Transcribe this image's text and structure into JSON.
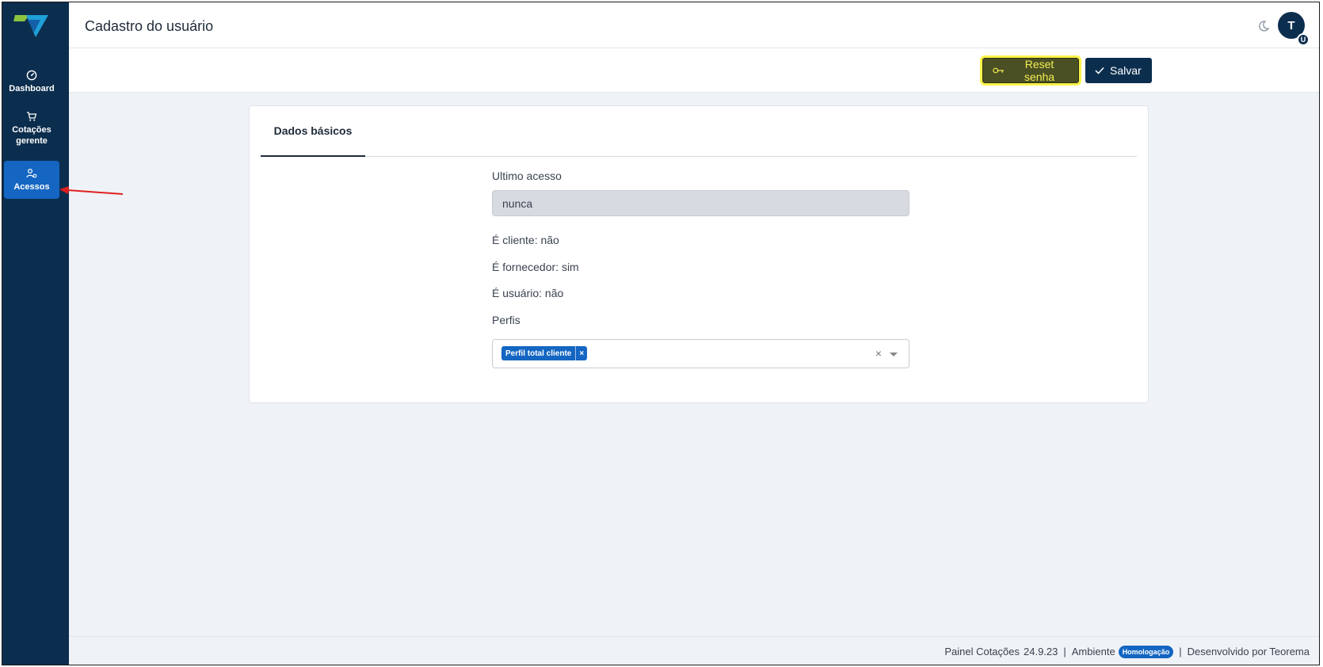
{
  "sidebar": {
    "items": [
      {
        "label": "Dashboard",
        "icon": "dashboard-icon"
      },
      {
        "label": "Cotações gerente",
        "icon": "cart-icon"
      },
      {
        "label": "Acessos",
        "icon": "users-access-icon",
        "active": true
      }
    ]
  },
  "header": {
    "title": "Cadastro do usuário",
    "avatar_initial": "T",
    "avatar_badge": "U"
  },
  "toolbar": {
    "reset_label": "Reset senha",
    "save_label": "Salvar"
  },
  "card": {
    "tab_label": "Dados básicos",
    "last_access_label": "Ultimo acesso",
    "last_access_value": "nunca",
    "is_client": "É cliente: não",
    "is_supplier": "É fornecedor: sim",
    "is_user": "É usuário: não",
    "profiles_label": "Perfis",
    "profiles_selected": [
      "Perfil total cliente"
    ]
  },
  "footer": {
    "app_name": "Painel Cotações",
    "version": "24.9.23",
    "env_label": "Ambiente",
    "env_badge": "Homologação",
    "developer": "Desenvolvido por Teorema"
  },
  "colors": {
    "sidebar_bg": "#0c2e4e",
    "accent": "#1466c2",
    "highlight": "#fbf24a",
    "annotation_arrow": "#e02020"
  }
}
